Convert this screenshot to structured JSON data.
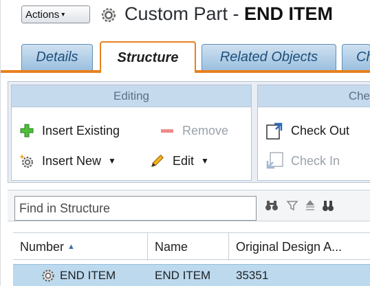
{
  "header": {
    "actions_label": "Actions",
    "title_prefix": "Custom Part - ",
    "title_bold": "END ITEM"
  },
  "tabs": [
    {
      "label": "Details",
      "active": false
    },
    {
      "label": "Structure",
      "active": true
    },
    {
      "label": "Related Objects",
      "active": false
    },
    {
      "label": "Ch",
      "active": false
    }
  ],
  "ribbon": {
    "editing": {
      "title": "Editing",
      "insert_existing": "Insert Existing",
      "remove": "Remove",
      "insert_new": "Insert New",
      "edit": "Edit"
    },
    "checkout": {
      "title": "Che",
      "check_out": "Check Out",
      "check_in": "Check In"
    }
  },
  "find": {
    "placeholder": "Find in Structure"
  },
  "table": {
    "columns": [
      "Number",
      "Name",
      "Original Design A..."
    ],
    "rows": [
      {
        "number": "END ITEM",
        "name": "END ITEM",
        "original": "35351"
      }
    ]
  },
  "colors": {
    "active_tab_border": "#e7811e",
    "tab_fill": "#9cc0df",
    "group_title": "#c6daee",
    "selected_row": "#bcd9ee"
  }
}
